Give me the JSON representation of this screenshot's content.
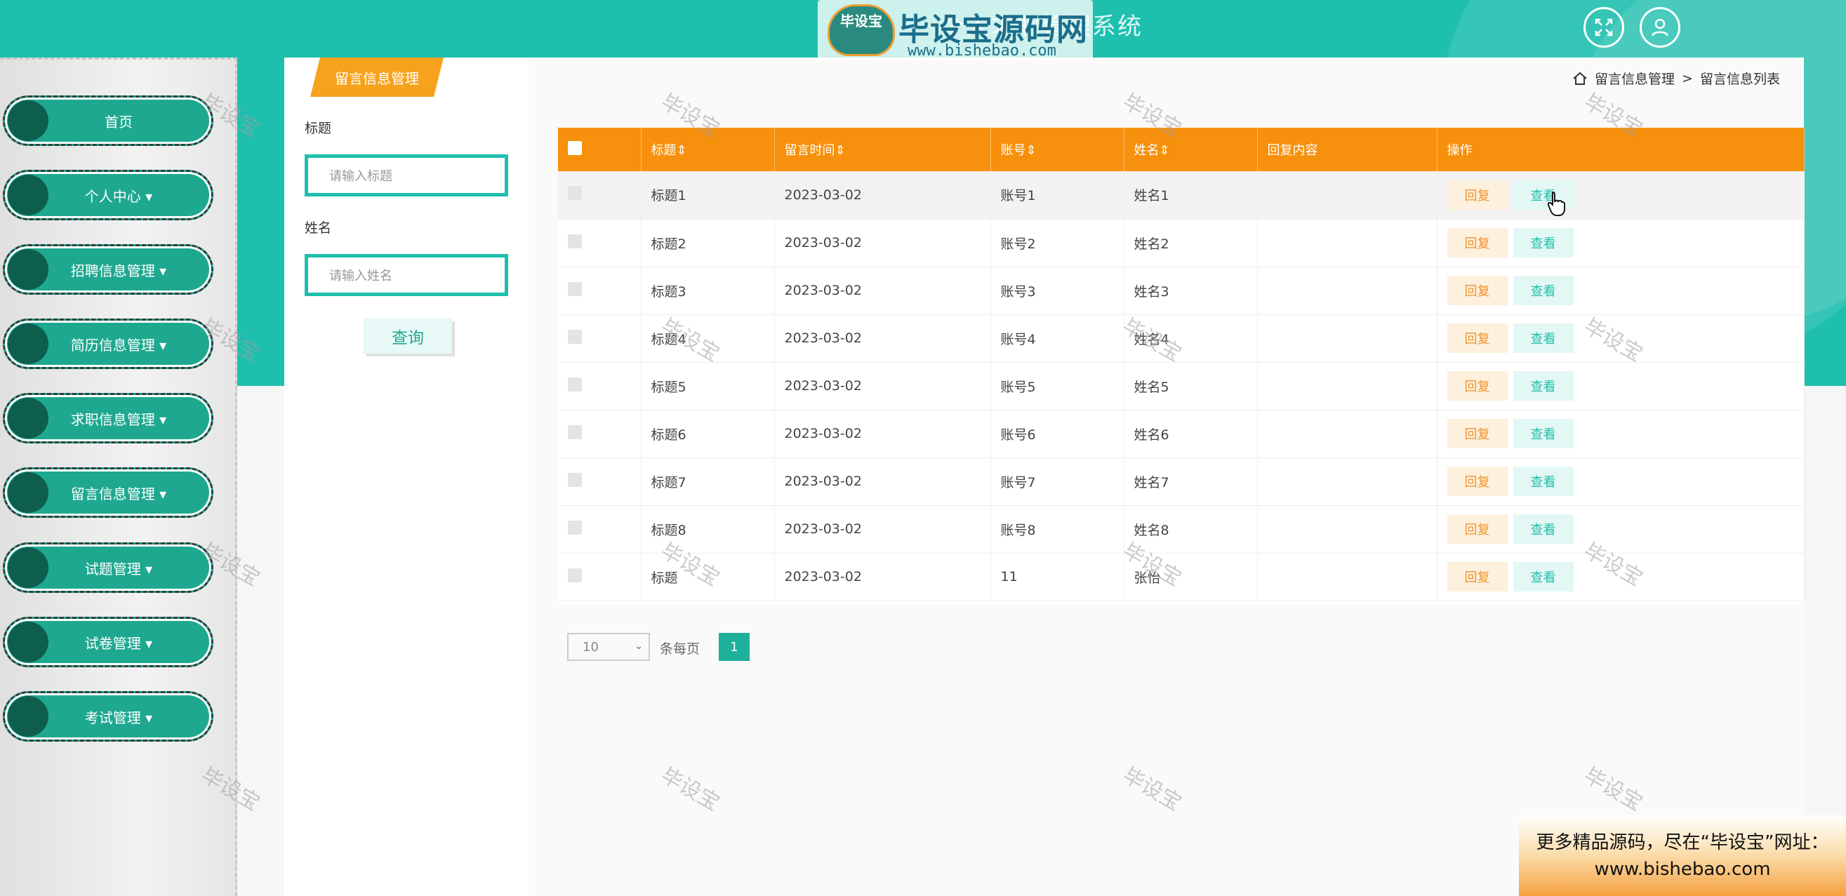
{
  "header": {
    "system_title": "个人求职管理系统",
    "fullscreen_icon": "fullscreen-icon",
    "user_icon": "user-icon"
  },
  "watermark_logo": {
    "badge": "毕设宝",
    "big": "毕设宝源码网",
    "url": "www.bishebao.com"
  },
  "sidebar": {
    "items": [
      {
        "label": "首页"
      },
      {
        "label": "个人中心 ▾"
      },
      {
        "label": "招聘信息管理 ▾"
      },
      {
        "label": "简历信息管理 ▾"
      },
      {
        "label": "求职信息管理 ▾"
      },
      {
        "label": "留言信息管理 ▾"
      },
      {
        "label": "试题管理 ▾"
      },
      {
        "label": "试卷管理 ▾"
      },
      {
        "label": "考试管理 ▾"
      }
    ]
  },
  "tab": {
    "label": "留言信息管理"
  },
  "filters": {
    "title_label": "标题",
    "title_placeholder": "请输入标题",
    "name_label": "姓名",
    "name_placeholder": "请输入姓名",
    "query_button": "查询"
  },
  "breadcrumb": {
    "parent": "留言信息管理",
    "separator": ">",
    "current": "留言信息列表"
  },
  "table": {
    "headers": [
      "标题⇕",
      "留言时间⇕",
      "账号⇕",
      "姓名⇕",
      "回复内容",
      "操作"
    ],
    "rows": [
      {
        "title": "标题1",
        "time": "2023-03-02",
        "account": "账号1",
        "name": "姓名1",
        "reply": ""
      },
      {
        "title": "标题2",
        "time": "2023-03-02",
        "account": "账号2",
        "name": "姓名2",
        "reply": ""
      },
      {
        "title": "标题3",
        "time": "2023-03-02",
        "account": "账号3",
        "name": "姓名3",
        "reply": ""
      },
      {
        "title": "标题4",
        "time": "2023-03-02",
        "account": "账号4",
        "name": "姓名4",
        "reply": ""
      },
      {
        "title": "标题5",
        "time": "2023-03-02",
        "account": "账号5",
        "name": "姓名5",
        "reply": ""
      },
      {
        "title": "标题6",
        "time": "2023-03-02",
        "account": "账号6",
        "name": "姓名6",
        "reply": ""
      },
      {
        "title": "标题7",
        "time": "2023-03-02",
        "account": "账号7",
        "name": "姓名7",
        "reply": ""
      },
      {
        "title": "标题8",
        "time": "2023-03-02",
        "account": "账号8",
        "name": "姓名8",
        "reply": ""
      },
      {
        "title": "标题",
        "time": "2023-03-02",
        "account": "11",
        "name": "张怡",
        "reply": ""
      }
    ],
    "reply_label": "回复",
    "view_label": "查看"
  },
  "pagination": {
    "page_size": "10",
    "per_page_label": "条每页",
    "current_page": "1"
  },
  "watermark_text": "毕设宝",
  "ad": {
    "line1": "更多精品源码，尽在“毕设宝”网址：",
    "line2": "www.bishebao.com"
  },
  "colors": {
    "primary_teal": "#1fbfae",
    "header_orange": "#f7900c",
    "tab_orange": "#f7a21c"
  }
}
